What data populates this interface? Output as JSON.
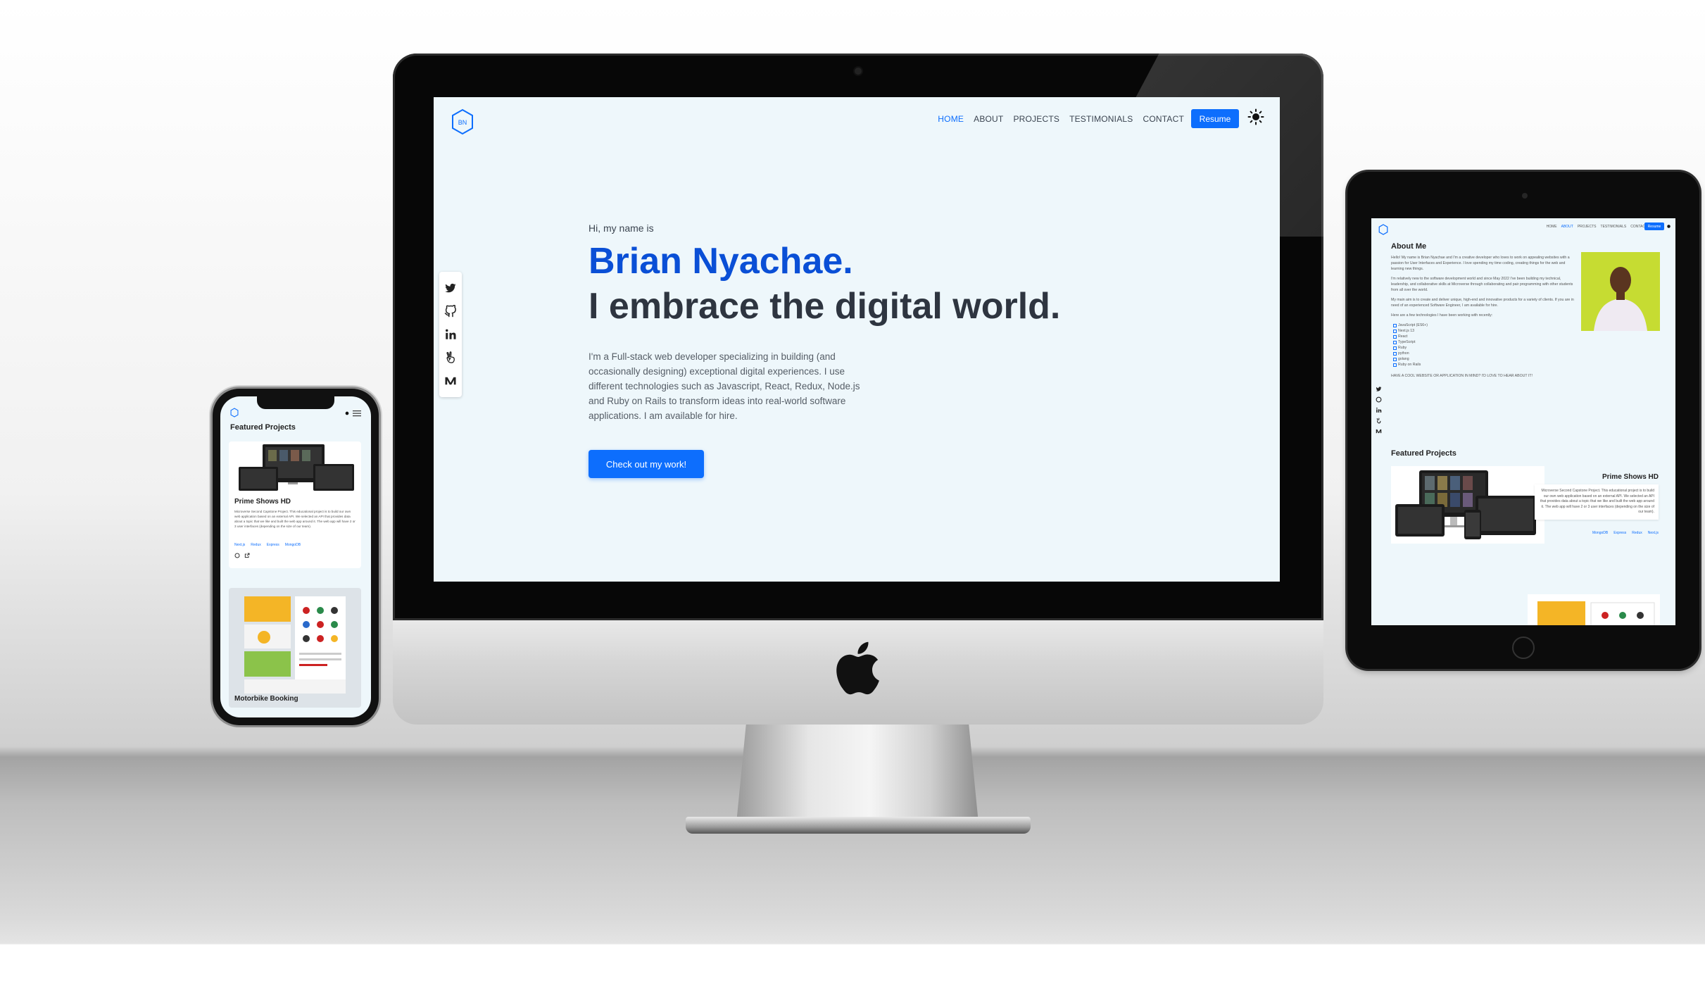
{
  "imac": {
    "logo_text": "BN",
    "nav": [
      {
        "label": "HOME",
        "active": true
      },
      {
        "label": "ABOUT",
        "active": false
      },
      {
        "label": "PROJECTS",
        "active": false
      },
      {
        "label": "TESTIMONIALS",
        "active": false
      },
      {
        "label": "CONTACT",
        "active": false
      }
    ],
    "resume_label": "Resume",
    "social_icons": [
      "twitter-icon",
      "github-icon",
      "linkedin-icon",
      "angellist-icon",
      "medium-icon"
    ],
    "hero": {
      "greeting": "Hi, my name is",
      "name": "Brian Nyachae.",
      "tagline": "I embrace the digital world.",
      "description": "I'm a Full-stack web developer specializing in building (and occasionally designing) exceptional digital experiences. I use different technologies such as Javascript, React, Redux, Node.js and Ruby on Rails to transform ideas into real-world software applications. I am available for hire.",
      "cta_label": "Check out my work!"
    }
  },
  "ipad": {
    "nav": [
      "HOME",
      "ABOUT",
      "PROJECTS",
      "TESTIMONIALS",
      "CONTACT"
    ],
    "resume_label": "Resume",
    "about_title": "About Me",
    "about_paragraphs": [
      "Hello! My name is Brian Nyachae and I'm a creative developer who loves to work on appealing websites with a passion for User Interfaces and Experience. I love spending my time coding, creating things for the web and learning new things.",
      "I'm relatively new to the software development world and since May 2022 I've been building my technical, leadership, and collaborative skills at Microverse through collaborating and pair programming with other students from all over the world.",
      "My main aim is to create and deliver unique, high-end and innovative products for a variety of clients. If you are in need of an experienced Software Engineer, I am available for hire.",
      "Here are a few technologies I have been working with recently:"
    ],
    "technologies": [
      "JavaScript (ES6+)",
      "Next.js 13",
      "React",
      "TypeScript",
      "Ruby",
      "python",
      "golang",
      "Ruby on Rails"
    ],
    "cta_text": "HAVE A COOL WEBSITE OR APPLICATION IN MIND? I'D LOVE TO HEAR ABOUT IT!",
    "featured_title": "Featured Projects",
    "project_title": "Prime Shows HD",
    "project_desc": "Microverse Second Capstone Project. This educational project is to build our own web application based on an external API. We selected an API that provides data about a topic that we like and built the web app around it. The web app will have 2 or 3 user interfaces (depending on the size of our team).",
    "project_tags": [
      "MongoDB",
      "Express",
      "Redux",
      "Next.js"
    ]
  },
  "iphone": {
    "featured_title": "Featured Projects",
    "project1_title": "Prime Shows HD",
    "project1_desc": "Microverse Second Capstone Project. This educational project is to build our own web application based on an external API. We selected an API that provides data about a topic that we like and built the web app around it. The web app will have 2 or 3 user interfaces (depending on the size of our team).",
    "project1_tags": [
      "Next.js",
      "Redux",
      "Express",
      "MongoDB"
    ],
    "project2_title": "Motorbike Booking"
  }
}
